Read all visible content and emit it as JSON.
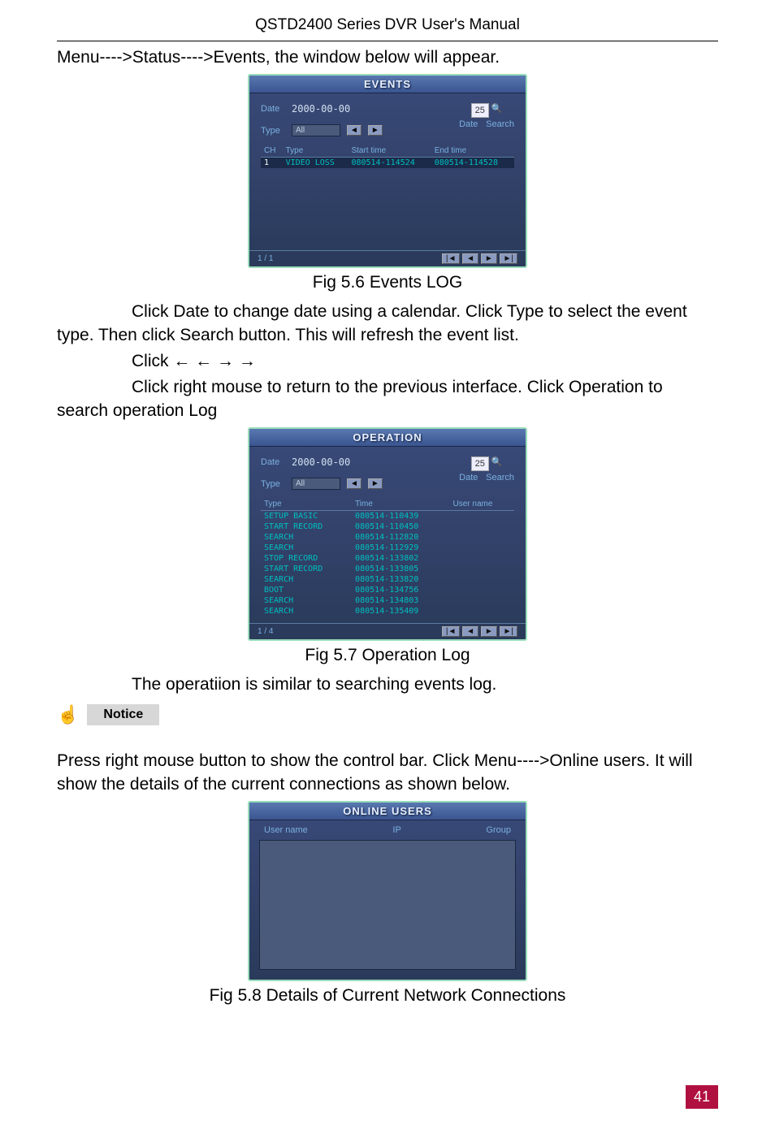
{
  "header": "QSTD2400 Series DVR User's Manual",
  "line1": "Menu---->Status---->Events, the window below will appear.",
  "events": {
    "title": "EVENTS",
    "date_label": "Date",
    "date_value": "2000-00-00",
    "type_label": "Type",
    "type_value": "All",
    "cal_value": "25",
    "date_btn": "Date",
    "search_btn": "Search",
    "cols": {
      "ch": "CH",
      "type": "Type",
      "start": "Start time",
      "end": "End time"
    },
    "rows": [
      {
        "ch": "1",
        "type": "VIDEO LOSS",
        "start": "080514-114524",
        "end": "080514-114528"
      }
    ],
    "pager": "1 / 1"
  },
  "caption1": "Fig 5.6 Events LOG",
  "para1a": "Click Date to change date using a calendar. Click Type to select the event type. Then click Search button. This will refresh the event list.",
  "para1b": "Click  ←   ←   →   →",
  "para1c": "Click right mouse to return to the previous interface. Click Operation to search operation Log",
  "operation": {
    "title": "OPERATION",
    "date_label": "Date",
    "date_value": "2000-00-00",
    "type_label": "Type",
    "type_value": "All",
    "cal_value": "25",
    "date_btn": "Date",
    "search_btn": "Search",
    "cols": {
      "type": "Type",
      "time": "Time",
      "user": "User name"
    },
    "rows": [
      {
        "type": "SETUP BASIC",
        "time": "080514-110439",
        "user": ""
      },
      {
        "type": "START RECORD",
        "time": "080514-110450",
        "user": ""
      },
      {
        "type": "SEARCH",
        "time": "080514-112820",
        "user": ""
      },
      {
        "type": "SEARCH",
        "time": "080514-112929",
        "user": ""
      },
      {
        "type": "STOP RECORD",
        "time": "080514-133802",
        "user": ""
      },
      {
        "type": "START RECORD",
        "time": "080514-133805",
        "user": ""
      },
      {
        "type": "SEARCH",
        "time": "080514-133820",
        "user": ""
      },
      {
        "type": "BOOT",
        "time": "080514-134756",
        "user": ""
      },
      {
        "type": "SEARCH",
        "time": "080514-134803",
        "user": ""
      },
      {
        "type": "SEARCH",
        "time": "080514-135409",
        "user": ""
      }
    ],
    "pager": "1 / 4"
  },
  "caption2": "Fig 5.7 Operation Log",
  "para2": "The operatiion is similar to searching events log.",
  "notice_label": "Notice",
  "para3": "Press right mouse button to show the control bar. Click Menu---->Online users. It will show the details of the current connections as shown below.",
  "online": {
    "title": "ONLINE USERS",
    "cols": {
      "user": "User name",
      "ip": "IP",
      "group": "Group"
    }
  },
  "caption3": "Fig 5.8 Details of Current Network Connections",
  "page_number": "41"
}
